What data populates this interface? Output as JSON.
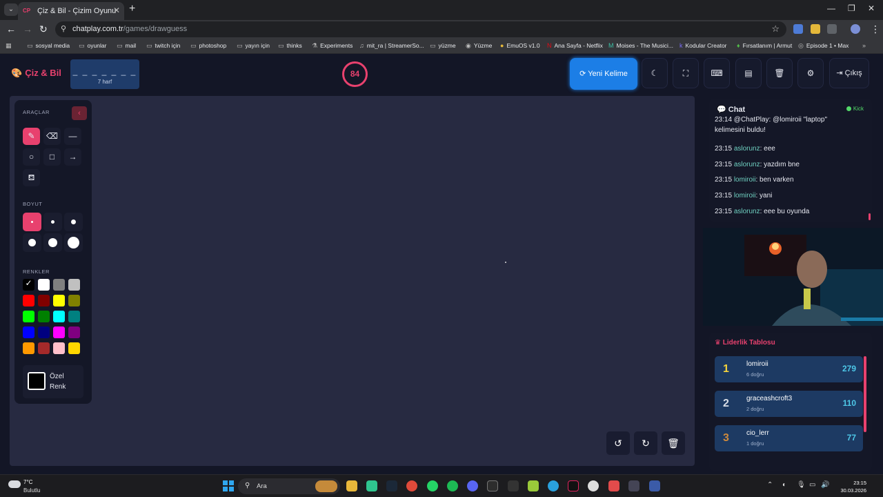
{
  "browser": {
    "tab_title": "Çiz & Bil - Çizim Oyunu",
    "favicon_text": "CP",
    "url_host": "chatplay.com.tr",
    "url_path": "/games/drawguess",
    "bookmarks": [
      {
        "label": "sosyal media",
        "icon": "folder-icon"
      },
      {
        "label": "oyunlar",
        "icon": "folder-icon"
      },
      {
        "label": "mail",
        "icon": "folder-icon"
      },
      {
        "label": "twitch için",
        "icon": "folder-icon"
      },
      {
        "label": "photoshop",
        "icon": "folder-icon"
      },
      {
        "label": "yayın için",
        "icon": "folder-icon"
      },
      {
        "label": "thinks",
        "icon": "folder-icon"
      },
      {
        "label": "Experiments",
        "icon": "flask-icon"
      },
      {
        "label": "mit_ra | StreamerSo...",
        "icon": "music-icon"
      },
      {
        "label": "yüzme",
        "icon": "folder-icon"
      },
      {
        "label": "Yüzme",
        "icon": "site-icon"
      },
      {
        "label": "EmuOS v1.0",
        "icon": "site-icon"
      },
      {
        "label": "Ana Sayfa - Netflix",
        "icon": "netflix-icon"
      },
      {
        "label": "Moises - The Musici...",
        "icon": "moises-icon"
      },
      {
        "label": "Kodular Creator",
        "icon": "kodular-icon"
      },
      {
        "label": "Fırsatlanım | Armut",
        "icon": "armut-icon"
      },
      {
        "label": "Episode 1 • Max",
        "icon": "max-icon"
      }
    ]
  },
  "app": {
    "logo": "Çiz & Bil",
    "word_mask": "_ _ _ _ _ _ _",
    "word_length": "7 harf",
    "timer": "84",
    "new_word": "Yeni Kelime",
    "exit": "Çıkış"
  },
  "tools": {
    "section_tools": "ARAÇLAR",
    "section_size": "BOYUT",
    "section_colors": "RENKLER",
    "custom_color": "Özel Renk",
    "colors": [
      "#000000",
      "#ffffff",
      "#808080",
      "#c0c0c0",
      "#ff0000",
      "#800000",
      "#ffff00",
      "#808000",
      "#00ff00",
      "#008000",
      "#00ffff",
      "#008080",
      "#0000ff",
      "#000080",
      "#ff00ff",
      "#800080",
      "#ff9900",
      "#a52a2a",
      "#ffc0cb",
      "#ffd700"
    ]
  },
  "chat": {
    "title": "Chat",
    "status": "Kick",
    "system_message": "23:14 @ChatPlay: @lomiroii \"laptop\" kelimesini buldu!",
    "messages": [
      {
        "time": "23:15",
        "user": "aslorunz",
        "text": ": eee"
      },
      {
        "time": "23:15",
        "user": "aslorunz",
        "text": ": yazdım bne"
      },
      {
        "time": "23:15",
        "user": "lomiroii",
        "text": ": ben varken"
      },
      {
        "time": "23:15",
        "user": "lomiroii",
        "text": ": yani"
      },
      {
        "time": "23:15",
        "user": "aslorunz",
        "text": ": eee bu oyunda"
      }
    ]
  },
  "leaderboard": {
    "title": "Liderlik Tablosu",
    "rows": [
      {
        "rank": "1",
        "name": "lomiroii",
        "correct": "6 doğru",
        "score": "279",
        "rank_color": "#f5d33c"
      },
      {
        "rank": "2",
        "name": "graceashcroft3",
        "correct": "2 doğru",
        "score": "110",
        "rank_color": "#d8dde6"
      },
      {
        "rank": "3",
        "name": "cio_lerr",
        "correct": "1 doğru",
        "score": "77",
        "rank_color": "#d08a3c"
      }
    ]
  },
  "taskbar": {
    "temp": "7°C",
    "weather": "Bulutlu",
    "search": "Ara",
    "time": "23:15",
    "date": "30.03.2026"
  }
}
